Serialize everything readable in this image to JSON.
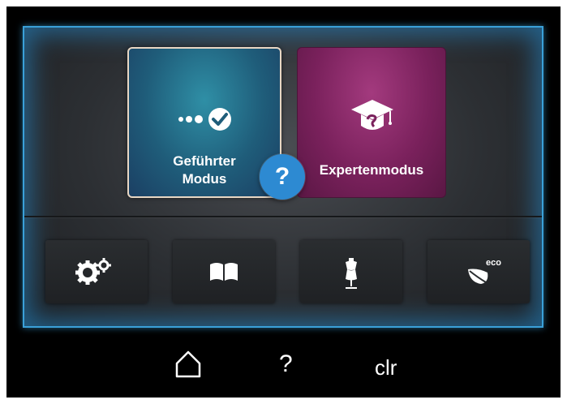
{
  "modes": {
    "guided_label_line1": "Geführter",
    "guided_label_line2": "Modus",
    "expert_label": "Expertenmodus"
  },
  "help_bubble": {
    "symbol": "?"
  },
  "function_buttons": [
    {
      "icon": "gears-icon"
    },
    {
      "icon": "book-icon"
    },
    {
      "icon": "dress-form-icon"
    },
    {
      "icon": "eco-leaf-icon",
      "text": "eco"
    }
  ],
  "bottom_bar": {
    "home_icon": "home-icon",
    "help_symbol": "?",
    "clear_label": "clr"
  },
  "colors": {
    "frame_glow": "#3aa0d8",
    "guided_tile": "#1f5d7a",
    "expert_tile": "#7a215c",
    "help_blue": "#2d8ad2"
  }
}
